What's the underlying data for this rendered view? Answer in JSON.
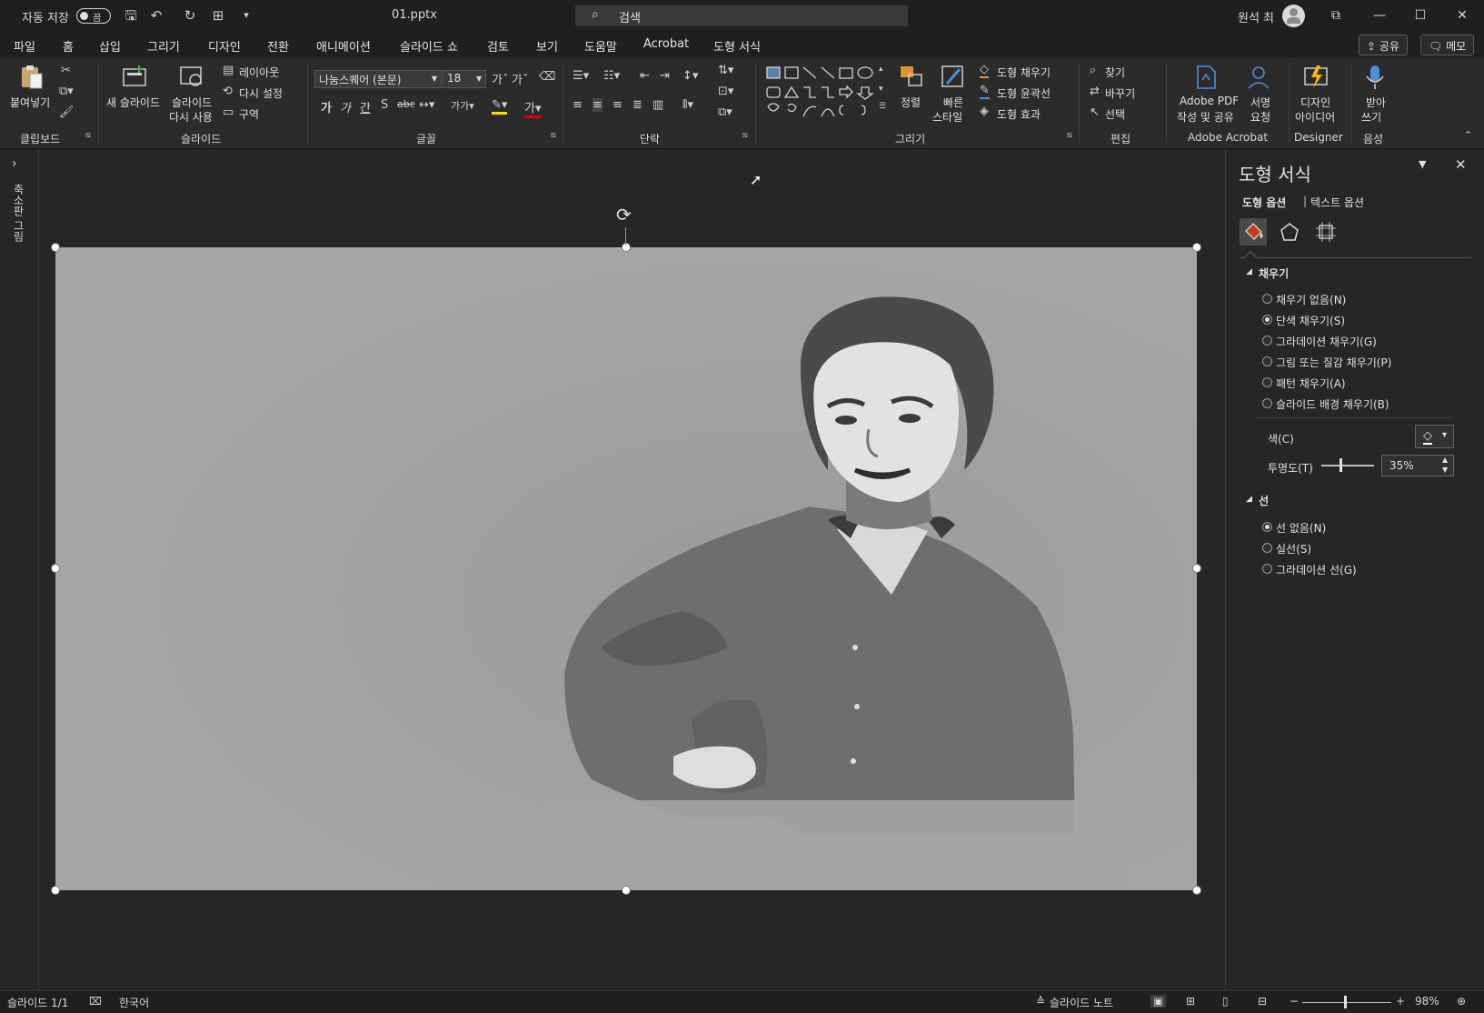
{
  "titlebar": {
    "autosave_label": "자동 저장",
    "autosave_state": "끔",
    "filename": "01.pptx",
    "search_placeholder": "검색",
    "user_name": "원석 최"
  },
  "menu": {
    "tabs": [
      "파일",
      "홈",
      "삽입",
      "그리기",
      "디자인",
      "전환",
      "애니메이션",
      "슬라이드 쇼",
      "검토",
      "보기",
      "도움말",
      "Acrobat",
      "도형 서식"
    ],
    "active_tab": "홈",
    "share_label": "공유",
    "memo_label": "메모"
  },
  "ribbon": {
    "clipboard": {
      "paste": "붙여넣기",
      "group": "클립보드"
    },
    "slides": {
      "new_slide": "새 슬라이드",
      "reuse_slide_1": "슬라이드",
      "reuse_slide_2": "다시 사용",
      "layout": "레이아웃",
      "reset": "다시 설정",
      "section": "구역",
      "group": "슬라이드"
    },
    "font": {
      "font_name": "나눔스퀘어 (본문)",
      "font_size": "18",
      "group": "글꼴"
    },
    "paragraph": {
      "group": "단락"
    },
    "drawing": {
      "arrange": "정렬",
      "quick_styles_1": "빠른",
      "quick_styles_2": "스타일",
      "shape_fill": "도형 채우기",
      "shape_outline": "도형 윤곽선",
      "shape_effects": "도형 효과",
      "group": "그리기"
    },
    "editing": {
      "find": "찾기",
      "replace": "바꾸기",
      "select": "선택",
      "group": "편집"
    },
    "acrobat": {
      "create_1": "Adobe PDF",
      "create_2": "작성 및 공유",
      "sign_1": "서명",
      "sign_2": "요청",
      "group": "Adobe Acrobat"
    },
    "designer": {
      "ideas_1": "디자인",
      "ideas_2": "아이디어",
      "group": "Designer"
    },
    "voice": {
      "dictate_1": "받아",
      "dictate_2": "쓰기",
      "group": "음성"
    }
  },
  "thumbnails": {
    "label": "축소판 그림"
  },
  "pane": {
    "title": "도형 서식",
    "tab_shape": "도형 옵션",
    "tab_text": "텍스트 옵션",
    "fill_section": "채우기",
    "fill_options": [
      {
        "label": "채우기 없음(N)",
        "selected": false
      },
      {
        "label": "단색 채우기(S)",
        "selected": true
      },
      {
        "label": "그라데이션 채우기(G)",
        "selected": false
      },
      {
        "label": "그림 또는 질감 채우기(P)",
        "selected": false
      },
      {
        "label": "패턴 채우기(A)",
        "selected": false
      },
      {
        "label": "슬라이드 배경 채우기(B)",
        "selected": false
      }
    ],
    "color_label": "색(C)",
    "transparency_label": "투명도(T)",
    "transparency_value": "35%",
    "transparency_fraction": 0.35,
    "line_section": "선",
    "line_options": [
      {
        "label": "선 없음(N)",
        "selected": true
      },
      {
        "label": "실선(S)",
        "selected": false
      },
      {
        "label": "그라데이션 선(G)",
        "selected": false
      }
    ]
  },
  "status": {
    "slide_info": "슬라이드 1/1",
    "language": "한국어",
    "notes": "슬라이드 노트",
    "zoom": "98%"
  },
  "colors": {
    "accent_fill_icon": "#c43e1c",
    "slide_bg": "#a4a4a4"
  }
}
